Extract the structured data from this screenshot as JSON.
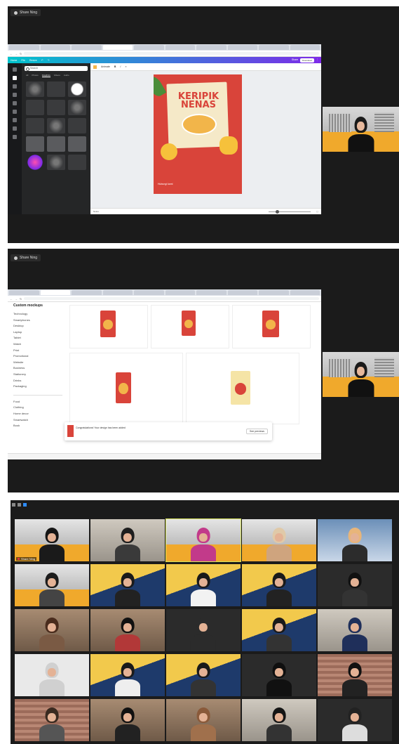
{
  "top_share": {
    "presenter_chip": "Share Ning",
    "canva": {
      "toolbar_left": [
        "Home",
        "File",
        "Resize"
      ],
      "toolbar_right": [
        "Share",
        "Download"
      ],
      "search_placeholder": "Search",
      "subtabs": [
        "All",
        "Photos",
        "Graphics",
        "Videos",
        "Audio"
      ],
      "editor_tool": "Animate",
      "poster_title": "KERIPIK NENAS",
      "poster_footer": "Hubungi kami",
      "footer_left": "Notes"
    }
  },
  "second_share": {
    "presenter_chip": "Share Ning",
    "sidebar_heading": "Custom mockups",
    "sidebar_items": [
      "Technology",
      "Smartphones",
      "Desktop",
      "Laptop",
      "Tablet",
      "Watch",
      "Print",
      "Promotional",
      "Website",
      "Business",
      "Stationery",
      "Drinks",
      "Packaging",
      "",
      "Food",
      "Clothing",
      "Home decor",
      "Smartwatch",
      "Book"
    ],
    "notice_text": "Congratulations! Your design has been added",
    "notice_button": "See previews"
  },
  "gallery": {
    "participants": [
      {
        "name": "Share Ning",
        "bg": "city",
        "hair": "#151515",
        "body": "#1a1a1a"
      },
      {
        "name": "",
        "bg": "room",
        "hair": "#1e1e1e",
        "body": "#3a3a3a"
      },
      {
        "name": "",
        "bg": "city",
        "hair": "#c23a8a",
        "body": "#c23a8a"
      },
      {
        "name": "",
        "bg": "city",
        "hair": "#e0c9a8",
        "body": "#cfa47e"
      },
      {
        "name": "",
        "bg": "blue",
        "hair": "#e8b57a",
        "body": "#2c2c2c"
      },
      {
        "name": "",
        "bg": "city",
        "hair": "#1c1c1c",
        "body": "#444"
      },
      {
        "name": "",
        "bg": "yellow",
        "hair": "#1a1a1a",
        "body": "#222"
      },
      {
        "name": "",
        "bg": "yellow",
        "hair": "#1a1a1a",
        "body": "#f2f2f2"
      },
      {
        "name": "",
        "bg": "yellow",
        "hair": "#1a1a1a",
        "body": "#222"
      },
      {
        "name": "",
        "bg": "dark",
        "hair": "#111",
        "body": "#333"
      },
      {
        "name": "",
        "bg": "warm",
        "hair": "#4a2c1d",
        "body": "#7a5a44"
      },
      {
        "name": "",
        "bg": "warm",
        "hair": "#111",
        "body": "#b23838"
      },
      {
        "name": "",
        "bg": "dark",
        "hair": "#2b2b2b",
        "body": "#2b2b2b"
      },
      {
        "name": "",
        "bg": "yellow",
        "hair": "#1a1a1a",
        "body": "#333"
      },
      {
        "name": "",
        "bg": "room",
        "hair": "#1f2f5a",
        "body": "#1f2f5a"
      },
      {
        "name": "",
        "bg": "white",
        "hair": "#d0d0d0",
        "body": "#d0d0d0"
      },
      {
        "name": "",
        "bg": "yellow",
        "hair": "#1a1a1a",
        "body": "#eee"
      },
      {
        "name": "",
        "bg": "yellow",
        "hair": "#1a1a1a",
        "body": "#333"
      },
      {
        "name": "",
        "bg": "dark",
        "hair": "#0f0f0f",
        "body": "#111"
      },
      {
        "name": "",
        "bg": "brick",
        "hair": "#111",
        "body": "#222"
      },
      {
        "name": "",
        "bg": "brick",
        "hair": "#3a2a20",
        "body": "#555"
      },
      {
        "name": "",
        "bg": "warm",
        "hair": "#111",
        "body": "#222"
      },
      {
        "name": "",
        "bg": "warm",
        "hair": "#8a5a3a",
        "body": "#a0704c"
      },
      {
        "name": "",
        "bg": "room",
        "hair": "#151515",
        "body": "#333"
      },
      {
        "name": "",
        "bg": "dark",
        "hair": "#222",
        "body": "#ddd"
      }
    ]
  }
}
